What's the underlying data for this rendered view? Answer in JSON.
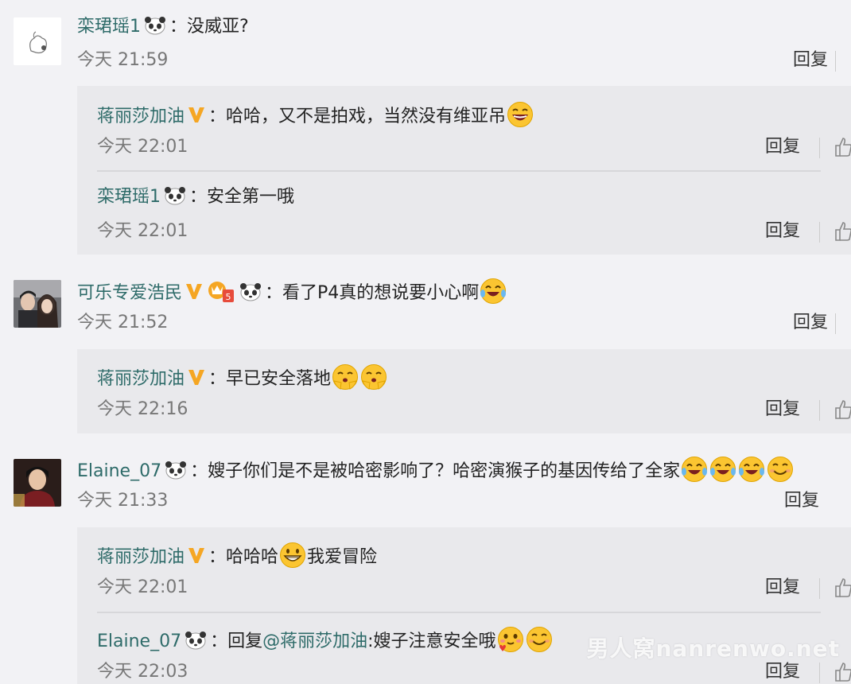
{
  "comments": [
    {
      "user": "栾珺瑶1",
      "text": "没威亚?",
      "time": "今天 21:59",
      "reply_label": "回复",
      "replies": [
        {
          "user": "蒋丽莎加油",
          "text": "哈哈，又不是拍戏，当然没有维亚吊",
          "time": "今天 22:01",
          "reply_label": "回复"
        },
        {
          "user": "栾珺瑶1",
          "text": "安全第一哦",
          "time": "今天 22:01",
          "reply_label": "回复"
        }
      ]
    },
    {
      "user": "可乐专爱浩民",
      "text": "看了P4真的想说要小心啊",
      "time": "今天 21:52",
      "reply_label": "回复",
      "replies": [
        {
          "user": "蒋丽莎加油",
          "text": "早已安全落地",
          "time": "今天 22:16",
          "reply_label": "回复"
        }
      ]
    },
    {
      "user": "Elaine_07",
      "text": "嫂子你们是不是被哈密影响了？哈密演猴子的基因传给了全家",
      "time": "今天 21:33",
      "reply_label": "回复",
      "replies": [
        {
          "user": "蒋丽莎加油",
          "text": "哈哈哈",
          "text2": "我爱冒险",
          "time": "今天 22:01",
          "reply_label": "回复"
        },
        {
          "user": "Elaine_07",
          "prefix": "回复",
          "mention": "@蒋丽莎加油",
          "text": ":嫂子注意安全哦",
          "time": "今天 22:03",
          "reply_label": "回复"
        }
      ]
    }
  ],
  "colon": "：",
  "crown_level": "5",
  "watermark": "男人窝nanrenwo.net",
  "colors": {
    "name": "#2e6b69",
    "vip": "#f5a623",
    "background": "#f2f2f5",
    "reply_box": "#e9e9ec"
  }
}
